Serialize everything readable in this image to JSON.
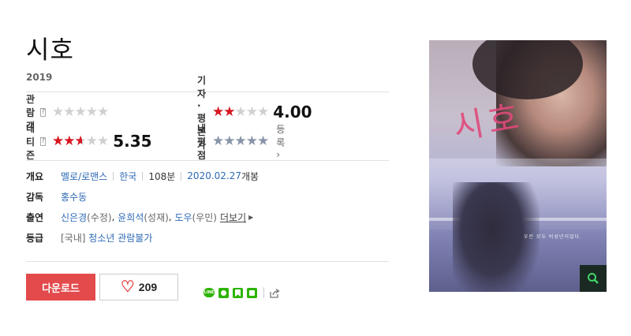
{
  "movie": {
    "title": "시호",
    "year": "2019"
  },
  "ratings": {
    "audience": {
      "label": "관람객",
      "help": "?",
      "value": 0
    },
    "critic": {
      "label": "기자·평론가",
      "value": 4.0,
      "score_text": "4.00"
    },
    "netizen": {
      "label": "네티즌",
      "help": "?",
      "value": 5.35,
      "score_text": "5.35"
    },
    "mine": {
      "label": "내 평점",
      "register": "등록"
    }
  },
  "details": {
    "overview": {
      "label": "개요",
      "genre": "멜로/로맨스",
      "country": "한국",
      "runtime": "108분",
      "release_date": "2020.02.27",
      "release_suffix": "개봉"
    },
    "director": {
      "label": "감독",
      "name": "홍수동"
    },
    "cast": {
      "label": "출연",
      "actors": [
        {
          "name": "신은경",
          "role": "(수정)"
        },
        {
          "name": "윤희석",
          "role": "(성재)"
        },
        {
          "name": "도우",
          "role": "(우민)"
        }
      ],
      "more": "더보기"
    },
    "grade": {
      "label": "등급",
      "region": "[국내]",
      "rating": "청소년 관람불가"
    }
  },
  "actions": {
    "download": "다운로드",
    "like_count": "209"
  },
  "share": {
    "icons": [
      "line-icon",
      "kakaotalk-icon",
      "naver-bookmark-icon",
      "band-icon",
      "export-icon"
    ]
  },
  "poster": {
    "title_text": "시호",
    "tagline": "우린 모두 비성년이었다."
  },
  "colors": {
    "accent_red": "#e34a4c",
    "star_red": "#d91520",
    "link_blue": "#2d6ab5",
    "share_green": "#2db400"
  }
}
